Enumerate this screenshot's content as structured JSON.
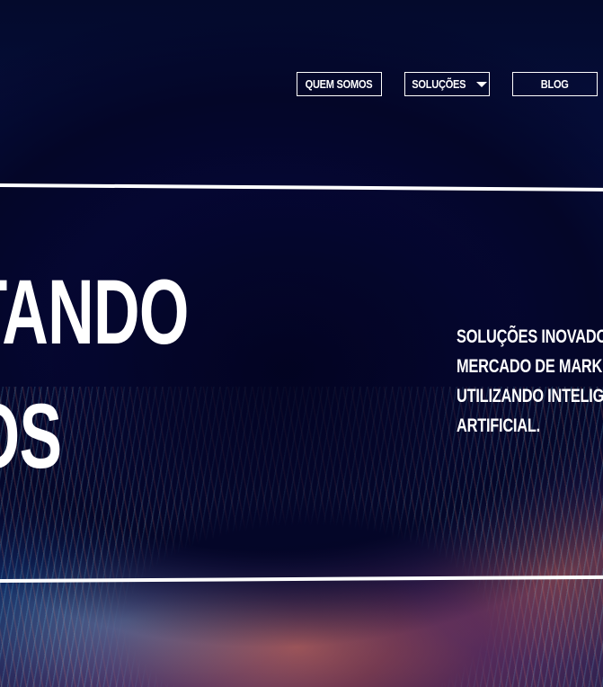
{
  "nav": {
    "items": [
      {
        "label": "QUEM SOMOS"
      },
      {
        "label": "SOLUÇÕES"
      },
      {
        "label": "BLOG"
      }
    ]
  },
  "hero": {
    "headline_line1": "CTANDO",
    "headline_line2": "OS",
    "tagline_lines": [
      "SOLUÇÕES INOVADORA",
      "MERCADO DE MARKET",
      "UTILIZANDO INTELIGÊN",
      "ARTIFICIAL."
    ]
  },
  "colors": {
    "background": "#040a2c",
    "text": "#ffffff",
    "accent_cyan": "#5ae6ff",
    "accent_orange": "#ff7860"
  }
}
